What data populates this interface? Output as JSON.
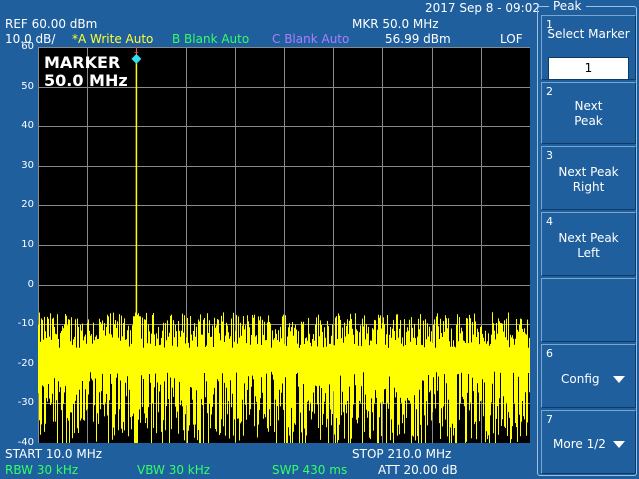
{
  "header": {
    "datetime": "2017 Sep 8 - 09:02",
    "ref": "REF  60.00 dBm",
    "scale": "10.0 dB/",
    "marker_freq": "MKR 50.0 MHz",
    "marker_level": "56.99 dBm",
    "lof": "LOF"
  },
  "traces": {
    "a": "*A Write Auto",
    "b": "B Blank Auto",
    "c": "C Blank Auto"
  },
  "marker_readout": {
    "title": "MARKER",
    "value": "50.0 MHz",
    "number": "1"
  },
  "footer": {
    "start": "START  10.0 MHz",
    "stop": "STOP 210.0 MHz",
    "rbw": "RBW  30 kHz",
    "vbw": "VBW  30 kHz",
    "swp": "SWP  430 ms",
    "att": "ATT 20.00 dB"
  },
  "panel": {
    "title": "Peak",
    "keys": [
      {
        "num": "1",
        "line1": "Select Marker",
        "value": "1"
      },
      {
        "num": "2",
        "line1": "Next",
        "line2": "Peak"
      },
      {
        "num": "3",
        "line1": "Next Peak",
        "line2": "Right"
      },
      {
        "num": "4",
        "line1": "Next Peak",
        "line2": "Left"
      },
      {
        "num": "6",
        "line1": "Config"
      },
      {
        "num": "7",
        "line1": "More 1/2"
      }
    ]
  },
  "colors": {
    "background": "#1f5f9e",
    "trace": "#ffff00",
    "marker": "#33ddee",
    "write_trace": "#ffff33",
    "blank_b": "#33ff66",
    "blank_c": "#b07cff"
  },
  "chart_data": {
    "type": "line",
    "x_unit": "MHz",
    "y_unit": "dBm",
    "xlim": [
      10.0,
      210.0
    ],
    "ylim": [
      -40,
      60
    ],
    "y_ticks": [
      "60",
      "50",
      "40",
      "30",
      "20",
      "10",
      "0",
      "-10",
      "-20",
      "-30",
      "-40"
    ],
    "x_divisions": 10,
    "grid": true,
    "peak": {
      "x": 50.0,
      "y": 56.99
    },
    "noise_floor_top": -13,
    "noise_floor_bottom": -40
  }
}
